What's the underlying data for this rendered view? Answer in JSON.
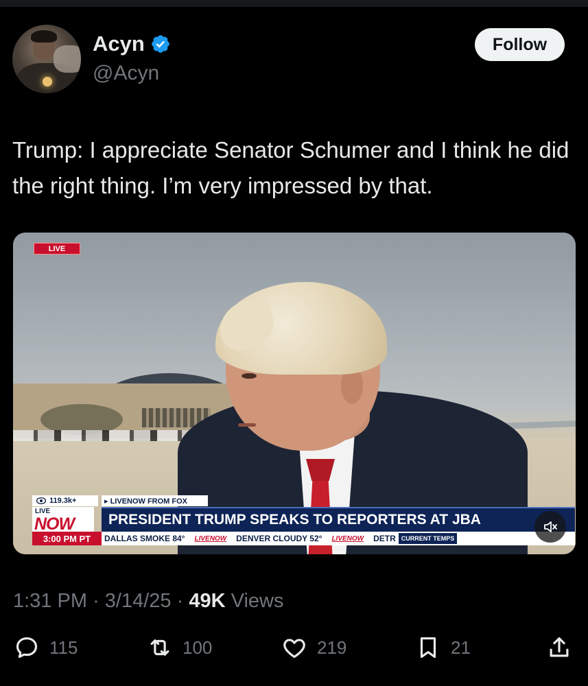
{
  "user": {
    "name": "Acyn",
    "handle": "@Acyn",
    "verified_icon": "verified-badge-icon"
  },
  "follow_button": {
    "label": "Follow"
  },
  "tweet": {
    "text": "Trump: I appreciate Senator Schumer and I think he did the right thing. I’m very impressed by that."
  },
  "video": {
    "live_badge": "LIVE",
    "viewer_count": "119.3k+",
    "source": "▸ LIVENOW FROM FOX",
    "livenow_live": "LIVE",
    "livenow_now": "NOW",
    "time": "3:00 PM PT",
    "headline": "PRESIDENT TRUMP SPEAKS TO REPORTERS AT JBA",
    "ticker": [
      "DALLAS   SMOKE 84°",
      "LIVENOW",
      "DENVER   CLOUDY 52°",
      "LIVENOW",
      "DETR",
      "CURRENT TEMPS"
    ],
    "mute_icon": "speaker-muted-icon"
  },
  "meta": {
    "time": "1:31 PM",
    "separator": "·",
    "date": "3/14/25",
    "views_count": "49K",
    "views_label": "Views"
  },
  "actions": {
    "replies": "115",
    "reposts": "100",
    "likes": "219",
    "bookmarks": "21"
  },
  "colors": {
    "background": "#000000",
    "text_primary": "#e7e9ea",
    "text_secondary": "#71767b",
    "verified": "#1d9bf0",
    "follow_bg": "#eff3f4"
  }
}
